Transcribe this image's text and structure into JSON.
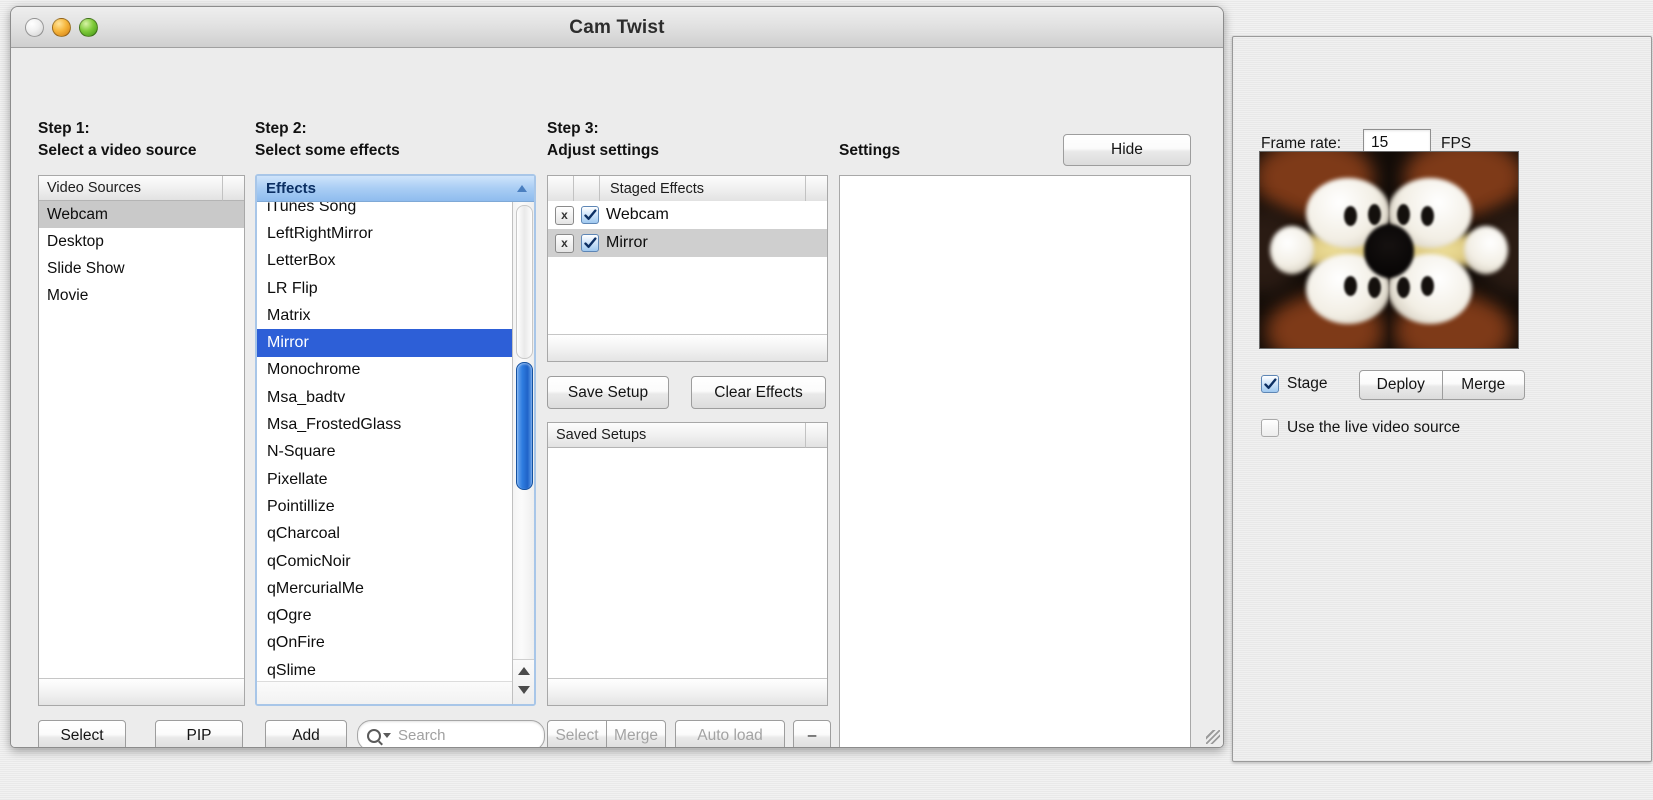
{
  "window": {
    "title": "Cam Twist",
    "traffic_lights": [
      "close-button",
      "minimize-button",
      "zoom-button"
    ]
  },
  "step1": {
    "heading": "Step 1:\nSelect a video source",
    "list_header": "Video Sources",
    "items": [
      {
        "label": "Webcam",
        "selected": true
      },
      {
        "label": "Desktop",
        "selected": false
      },
      {
        "label": "Slide Show",
        "selected": false
      },
      {
        "label": "Movie",
        "selected": false
      }
    ],
    "buttons": {
      "select": "Select",
      "pip": "PIP"
    }
  },
  "step2": {
    "heading": "Step 2:\nSelect some effects",
    "list_header": "Effects",
    "sort_indicator": "sort-ascending-arrow",
    "items": [
      {
        "label": "iTunes Song",
        "selected": false
      },
      {
        "label": "LeftRightMirror",
        "selected": false
      },
      {
        "label": "LetterBox",
        "selected": false
      },
      {
        "label": "LR Flip",
        "selected": false
      },
      {
        "label": "Matrix",
        "selected": false
      },
      {
        "label": "Mirror",
        "selected": true
      },
      {
        "label": "Monochrome",
        "selected": false
      },
      {
        "label": "Msa_badtv",
        "selected": false
      },
      {
        "label": "Msa_FrostedGlass",
        "selected": false
      },
      {
        "label": "N-Square",
        "selected": false
      },
      {
        "label": "Pixellate",
        "selected": false
      },
      {
        "label": "Pointillize",
        "selected": false
      },
      {
        "label": "qCharcoal",
        "selected": false
      },
      {
        "label": "qComicNoir",
        "selected": false
      },
      {
        "label": "qMercurialMe",
        "selected": false
      },
      {
        "label": "qOgre",
        "selected": false
      },
      {
        "label": "qOnFire",
        "selected": false
      },
      {
        "label": "qSlime",
        "selected": false
      }
    ],
    "add_button": "Add",
    "search": {
      "placeholder": "Search",
      "value": ""
    }
  },
  "step3": {
    "heading": "Step 3:\nAdjust settings",
    "staged_header": "Staged Effects",
    "staged": [
      {
        "label": "Webcam",
        "enabled": true,
        "highlighted": false,
        "remove": "x"
      },
      {
        "label": "Mirror",
        "enabled": true,
        "highlighted": true,
        "remove": "x"
      }
    ],
    "save_setup": "Save Setup",
    "clear_effects": "Clear Effects",
    "saved_setups_header": "Saved Setups",
    "saved_setups": [],
    "footer_buttons": {
      "select": "Select",
      "merge": "Merge",
      "auto_load": "Auto load",
      "minus": "–"
    }
  },
  "settings": {
    "label": "Settings",
    "hide_button": "Hide",
    "content": ""
  },
  "right_panel": {
    "frame_rate_label": "Frame rate:",
    "frame_rate_value": "15",
    "fps_label": "FPS",
    "preview_name": "video-preview",
    "stage_label": "Stage",
    "stage_checked": true,
    "deploy_button": "Deploy",
    "merge_button": "Merge",
    "live_source_label": "Use the live video source",
    "live_source_checked": false
  },
  "colors": {
    "selection_blue": "#2d5fd7",
    "header_blue": "#a9cdf4",
    "selection_gray": "#c9c9c9",
    "window_bg": "#ececec",
    "scrollbar_thumb": "#2f7de0"
  }
}
